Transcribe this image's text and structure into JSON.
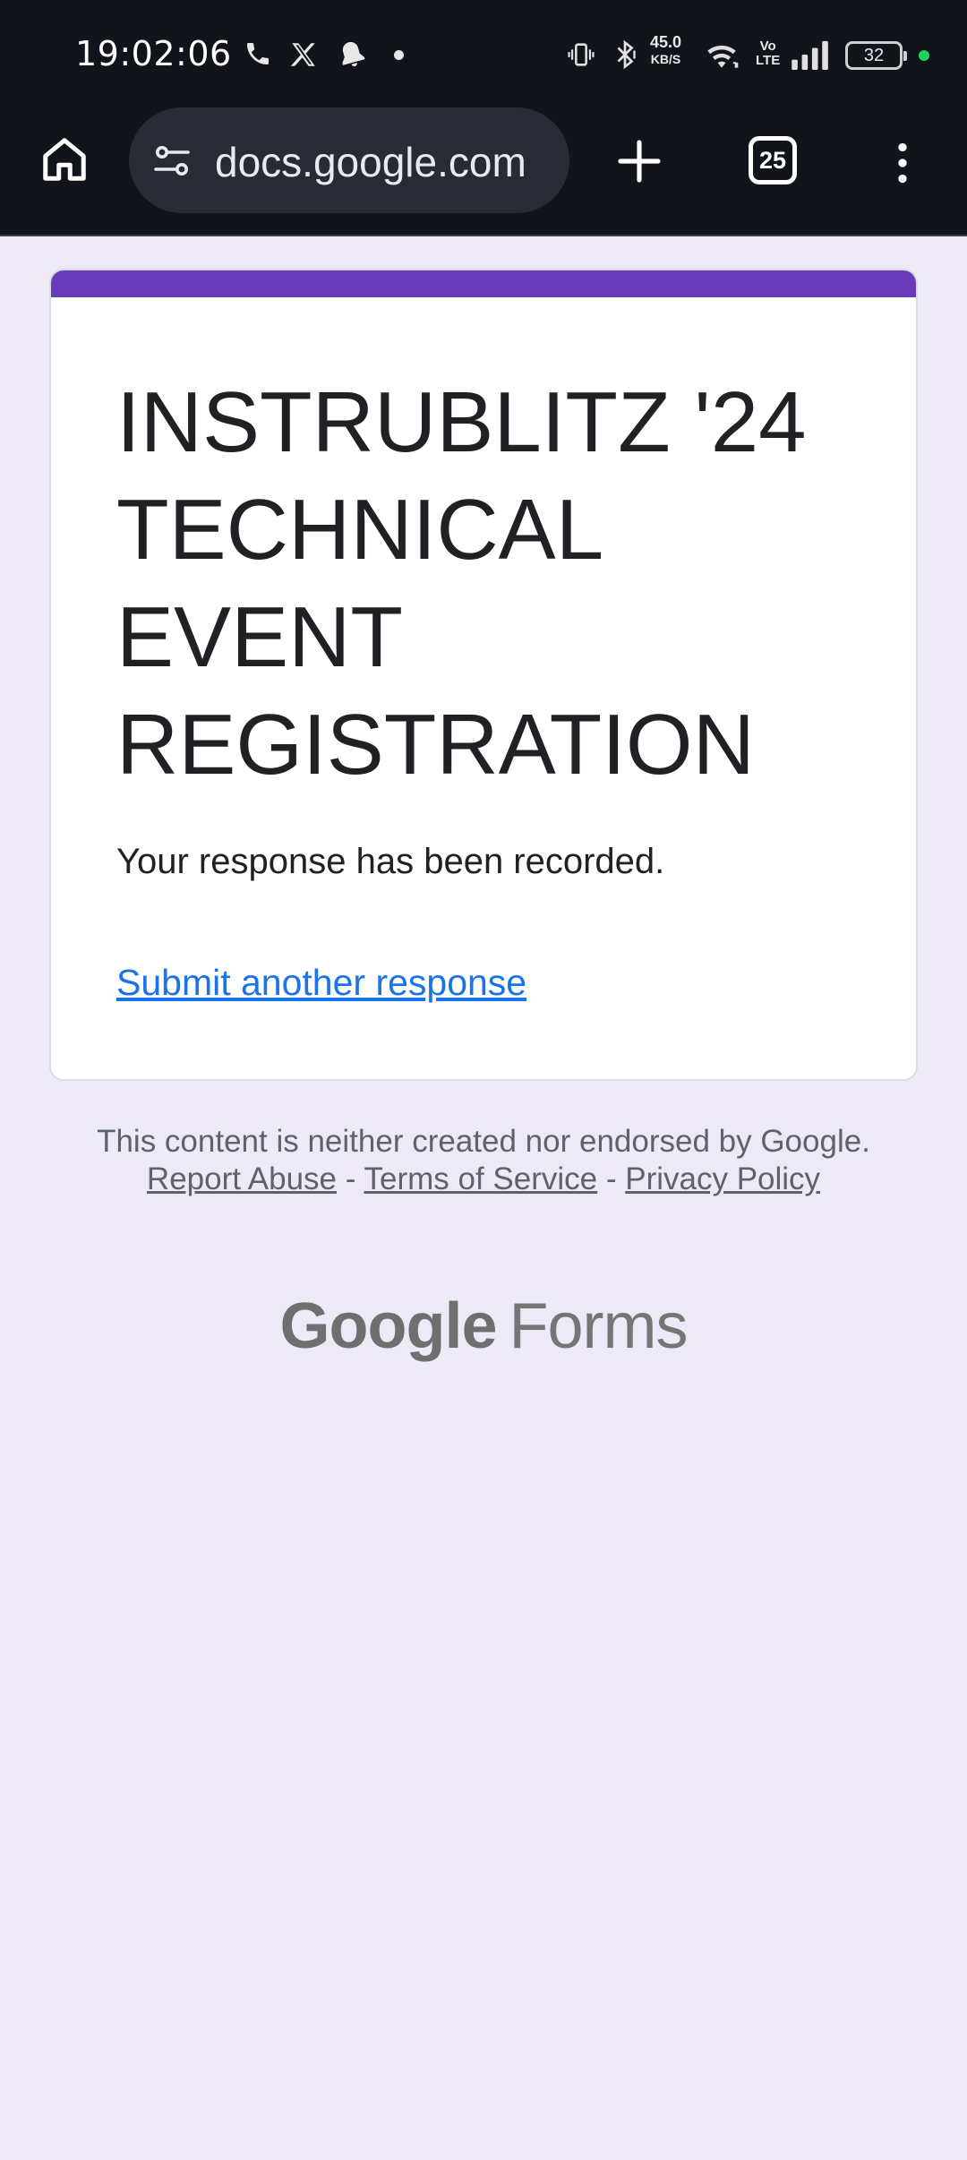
{
  "status_bar": {
    "time": "19:02:06",
    "net_speed_value": "45.0",
    "net_speed_unit": "KB/S",
    "volte_line1": "Vo",
    "volte_line2": "LTE",
    "battery": "32",
    "icons": [
      "phone-icon",
      "x-app-icon",
      "notification-bell-icon",
      "dot-icon",
      "vibrate-icon",
      "bluetooth-icon",
      "wifi-icon",
      "signal-icon",
      "battery-icon"
    ]
  },
  "toolbar": {
    "url": "docs.google.com",
    "tabs_count": "25",
    "icons": [
      "home-icon",
      "site-settings-icon",
      "new-tab-icon",
      "tab-switcher-icon",
      "more-menu-icon"
    ]
  },
  "form": {
    "title": "INSTRUBLITZ '24 TECHNICAL EVENT REGISTRATION",
    "confirmation": "Your response has been recorded.",
    "another_link": "Submit another response",
    "accent_color": "#673ab7"
  },
  "footer": {
    "disclaimer_text": "This content is neither created nor endorsed by Google.",
    "report_abuse": "Report Abuse",
    "separator": " - ",
    "terms": "Terms of Service",
    "privacy": "Privacy Policy",
    "logo_google": "Google",
    "logo_forms": "Forms"
  }
}
